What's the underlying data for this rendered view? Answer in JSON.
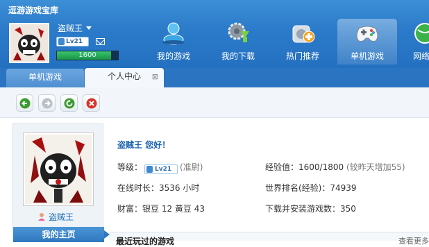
{
  "app_title": "逗游游戏宝库",
  "user": {
    "name": "盗贼王",
    "level_text": "Lv21",
    "exp_value": "1600",
    "exp_fraction": 0.889
  },
  "nav": [
    {
      "label": "我的游戏",
      "icon": "person-icon"
    },
    {
      "label": "我的下载",
      "icon": "gear-download-icon"
    },
    {
      "label": "热门推荐",
      "icon": "gem-plus-icon"
    },
    {
      "label": "单机游戏",
      "icon": "gamepad-icon"
    },
    {
      "label": "网络",
      "icon": "globe-icon"
    }
  ],
  "tabs": [
    {
      "label": "单机游戏"
    },
    {
      "label": "个人中心",
      "close": "⊠"
    }
  ],
  "toolbar_icons": [
    "back-icon",
    "forward-icon",
    "refresh-icon",
    "stop-icon"
  ],
  "profile": {
    "greeting": "盗贼王  您好！",
    "level_label": "等级：",
    "level_badge": "Lv21",
    "rank_title": "(准尉)",
    "online_time": "在线时长：3536 小时",
    "wealth": "财富：银豆 12  黄豆 43",
    "exp_label": "经验值：1600/1800",
    "exp_increase": "(较昨天增加55)",
    "world_rank": "世界排名(经验)：74939",
    "download_count": "下载并安装游戏数：350"
  },
  "left_panel": {
    "username": "盗贼王",
    "home_label": "我的主页"
  },
  "recent": {
    "title": "最近玩过的游戏",
    "more": "查看更多"
  },
  "colors": {
    "header_blue": "#2c7ccb",
    "link_blue": "#1a62ad",
    "exp_green": "#1a9348"
  }
}
